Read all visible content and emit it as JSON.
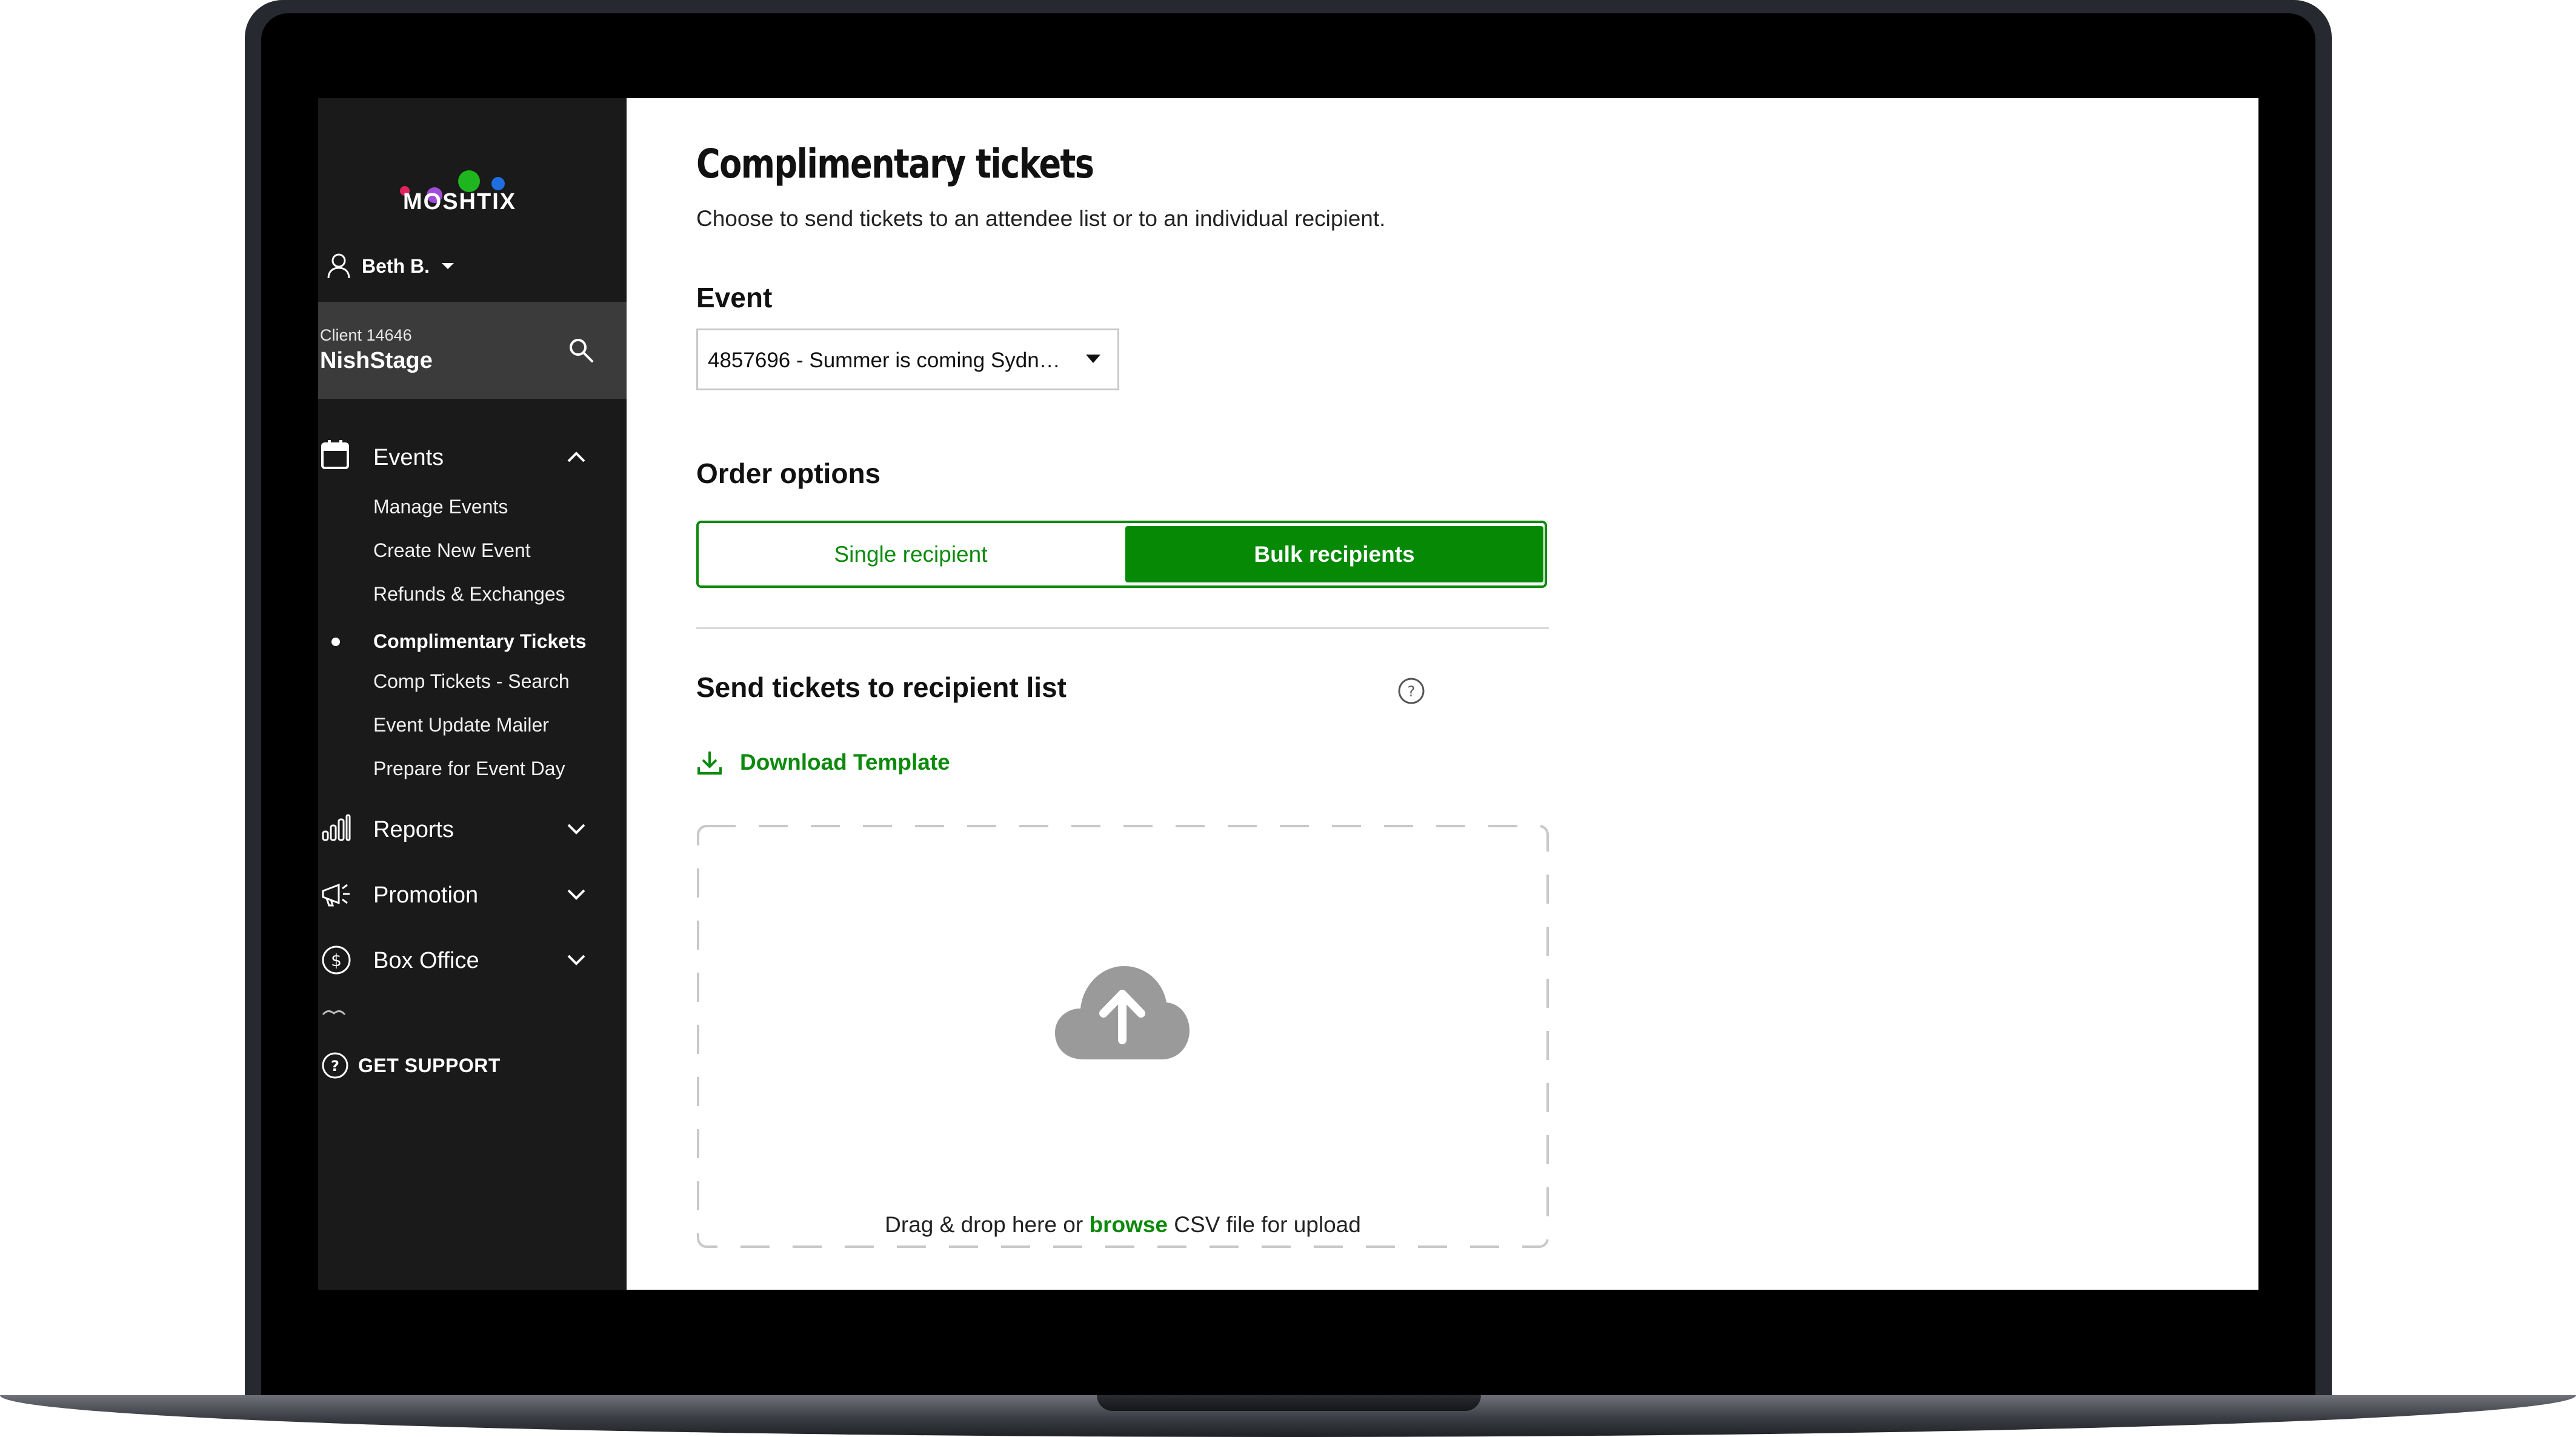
{
  "brand": {
    "name": "MOSHTIX",
    "dot_colors": [
      "#e0245e",
      "#a24bd9",
      "#1fb51f",
      "#1f6fe0"
    ],
    "accent": "#068a06"
  },
  "user": {
    "name": "Beth B."
  },
  "client": {
    "id": "Client 14646",
    "name": "NishStage"
  },
  "sidebar": {
    "events_label": "Events",
    "sub_items": [
      "Manage Events",
      "Create New Event",
      "Refunds & Exchanges",
      "Complimentary Tickets",
      "Comp Tickets - Search",
      "Event Update Mailer",
      "Prepare for Event Day"
    ],
    "active_sub_item": "Complimentary Tickets",
    "reports_label": "Reports",
    "promotion_label": "Promotion",
    "box_office_label": "Box Office",
    "support_label": "GET SUPPORT"
  },
  "page": {
    "title": "Complimentary tickets",
    "subtitle": "Choose to send tickets to an attendee list or to an individual recipient.",
    "event_label": "Event",
    "event_value": "4857696 - Summer is coming Sydn…",
    "order_options_label": "Order options",
    "single_recipient": "Single recipient",
    "bulk_recipients": "Bulk recipients",
    "selected_option": "Bulk recipients",
    "send_list_label": "Send tickets to recipient list",
    "download_template": "Download Template",
    "drop_prefix": "Drag & drop here or ",
    "drop_browse": "browse",
    "drop_suffix": " CSV file for upload"
  }
}
